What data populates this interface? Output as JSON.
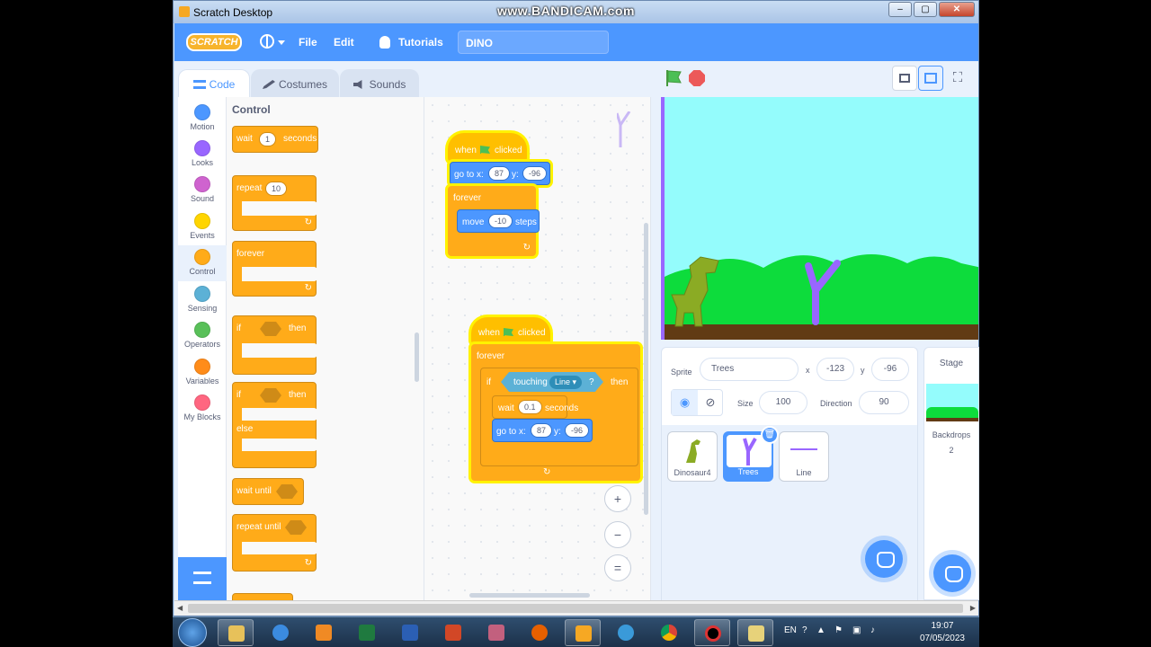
{
  "window": {
    "title": "Scratch Desktop",
    "watermark": "www.BANDICAM.com",
    "minimize": "–",
    "maximize": "▢",
    "close": "✕"
  },
  "menubar": {
    "logo": "SCRATCH",
    "file": "File",
    "edit": "Edit",
    "tutorials": "Tutorials",
    "project_name": "DINO"
  },
  "tabs": {
    "code": "Code",
    "costumes": "Costumes",
    "sounds": "Sounds"
  },
  "categories": [
    {
      "label": "Motion",
      "color": "#4c97ff"
    },
    {
      "label": "Looks",
      "color": "#9966ff"
    },
    {
      "label": "Sound",
      "color": "#cf63cf"
    },
    {
      "label": "Events",
      "color": "#ffd500"
    },
    {
      "label": "Control",
      "color": "#ffab19"
    },
    {
      "label": "Sensing",
      "color": "#5cb1d6"
    },
    {
      "label": "Operators",
      "color": "#59c059"
    },
    {
      "label": "Variables",
      "color": "#ff8c1a"
    },
    {
      "label": "My Blocks",
      "color": "#ff6680"
    }
  ],
  "palette": {
    "title": "Control",
    "wait": "wait",
    "wait_value": "1",
    "seconds": "seconds",
    "repeat": "repeat",
    "repeat_value": "10",
    "forever": "forever",
    "if": "if",
    "then": "then",
    "if2": "if",
    "then2": "then",
    "else": "else",
    "wait_until": "wait until",
    "repeat_until": "repeat until"
  },
  "script1": {
    "when": "when",
    "clicked": "clicked",
    "goto": "go to x:",
    "x_value": "87",
    "y_label": "y:",
    "y_value": "-96",
    "forever": "forever",
    "move": "move",
    "move_value": "-10",
    "steps": "steps"
  },
  "script2": {
    "when": "when",
    "clicked": "clicked",
    "forever": "forever",
    "if": "if",
    "touching": "touching",
    "touching_target": "Line",
    "question": "?",
    "then": "then",
    "wait": "wait",
    "wait_value": "0.1",
    "seconds": "seconds",
    "goto": "go to x:",
    "x_value": "87",
    "y_label": "y:",
    "y_value": "-96"
  },
  "zoom": {
    "in": "+",
    "out": "−",
    "reset": "="
  },
  "sprite_info": {
    "sprite_label": "Sprite",
    "sprite_name": "Trees",
    "x_label": "x",
    "x_value": "-123",
    "y_label": "y",
    "y_value": "-96",
    "size_label": "Size",
    "size_value": "100",
    "direction_label": "Direction",
    "direction_value": "90"
  },
  "sprites": [
    {
      "name": "Dinosaur4"
    },
    {
      "name": "Trees"
    },
    {
      "name": "Line"
    }
  ],
  "stage_pane": {
    "title": "Stage",
    "backdrops_label": "Backdrops",
    "backdrops_count": "2"
  },
  "taskbar": {
    "lang": "EN",
    "time": "19:07",
    "date": "07/05/2023"
  }
}
